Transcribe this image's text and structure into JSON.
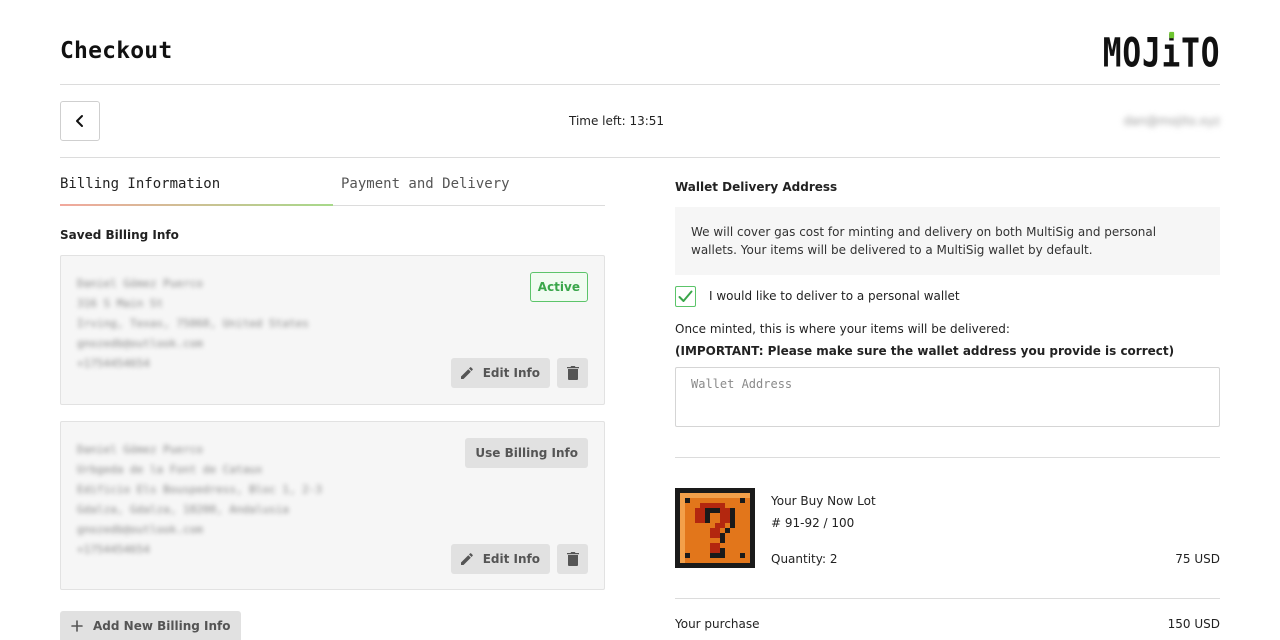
{
  "header": {
    "title": "Checkout",
    "logo_text_before": "MOJ",
    "logo_text_i": "i",
    "logo_text_after": "TO",
    "accent_color": "#6ec531"
  },
  "topbar": {
    "back_icon": "chevron-left-icon",
    "time_left": "Time left: 13:51",
    "user_email": "dan@mojito.xyz"
  },
  "tabs": [
    {
      "label": "Billing Information",
      "active": true
    },
    {
      "label": "Payment and Delivery",
      "active": false
    }
  ],
  "billing": {
    "saved_label": "Saved Billing Info",
    "cards": [
      {
        "lines": [
          "Daniel Gómez Puerco",
          "316 S Main St",
          "Irving, Texas, 75060, United States",
          "gnozedb@outlook.com",
          "+1754454654"
        ],
        "status": "Active",
        "edit_label": "Edit Info"
      },
      {
        "lines": [
          "Daniel Gómez Puerco",
          "Urbgeda de la Font de Cataux",
          "Edificio Els Bouspedress, Bloc 1, 2-3",
          "Gdalza, Gdalza, 18200, Andalusia",
          "gnozedb@outlook.com",
          "+1754454654"
        ],
        "use_label": "Use Billing Info",
        "edit_label": "Edit Info"
      }
    ],
    "add_label": "Add New Billing Info"
  },
  "delivery": {
    "section_label": "Wallet Delivery Address",
    "info_text": "We will cover gas cost for minting and delivery on both MultiSig and personal wallets. Your items will be delivered to a MultiSig wallet by default.",
    "checkbox_checked": true,
    "checkbox_label": "I would like to deliver to a personal wallet",
    "minted_text": "Once minted, this is where your items will be delivered:",
    "important_text": "(IMPORTANT: Please make sure the wallet address you provide is correct)",
    "wallet_placeholder": "Wallet Address",
    "wallet_value": ""
  },
  "order": {
    "lot_title": "Your Buy Now Lot",
    "lot_edition": "# 91-92 / 100",
    "quantity": "Quantity: 2",
    "lot_price": "75 USD",
    "purchase_label": "Your purchase",
    "purchase_total": "150 USD",
    "lot_image": "question-block-image"
  }
}
